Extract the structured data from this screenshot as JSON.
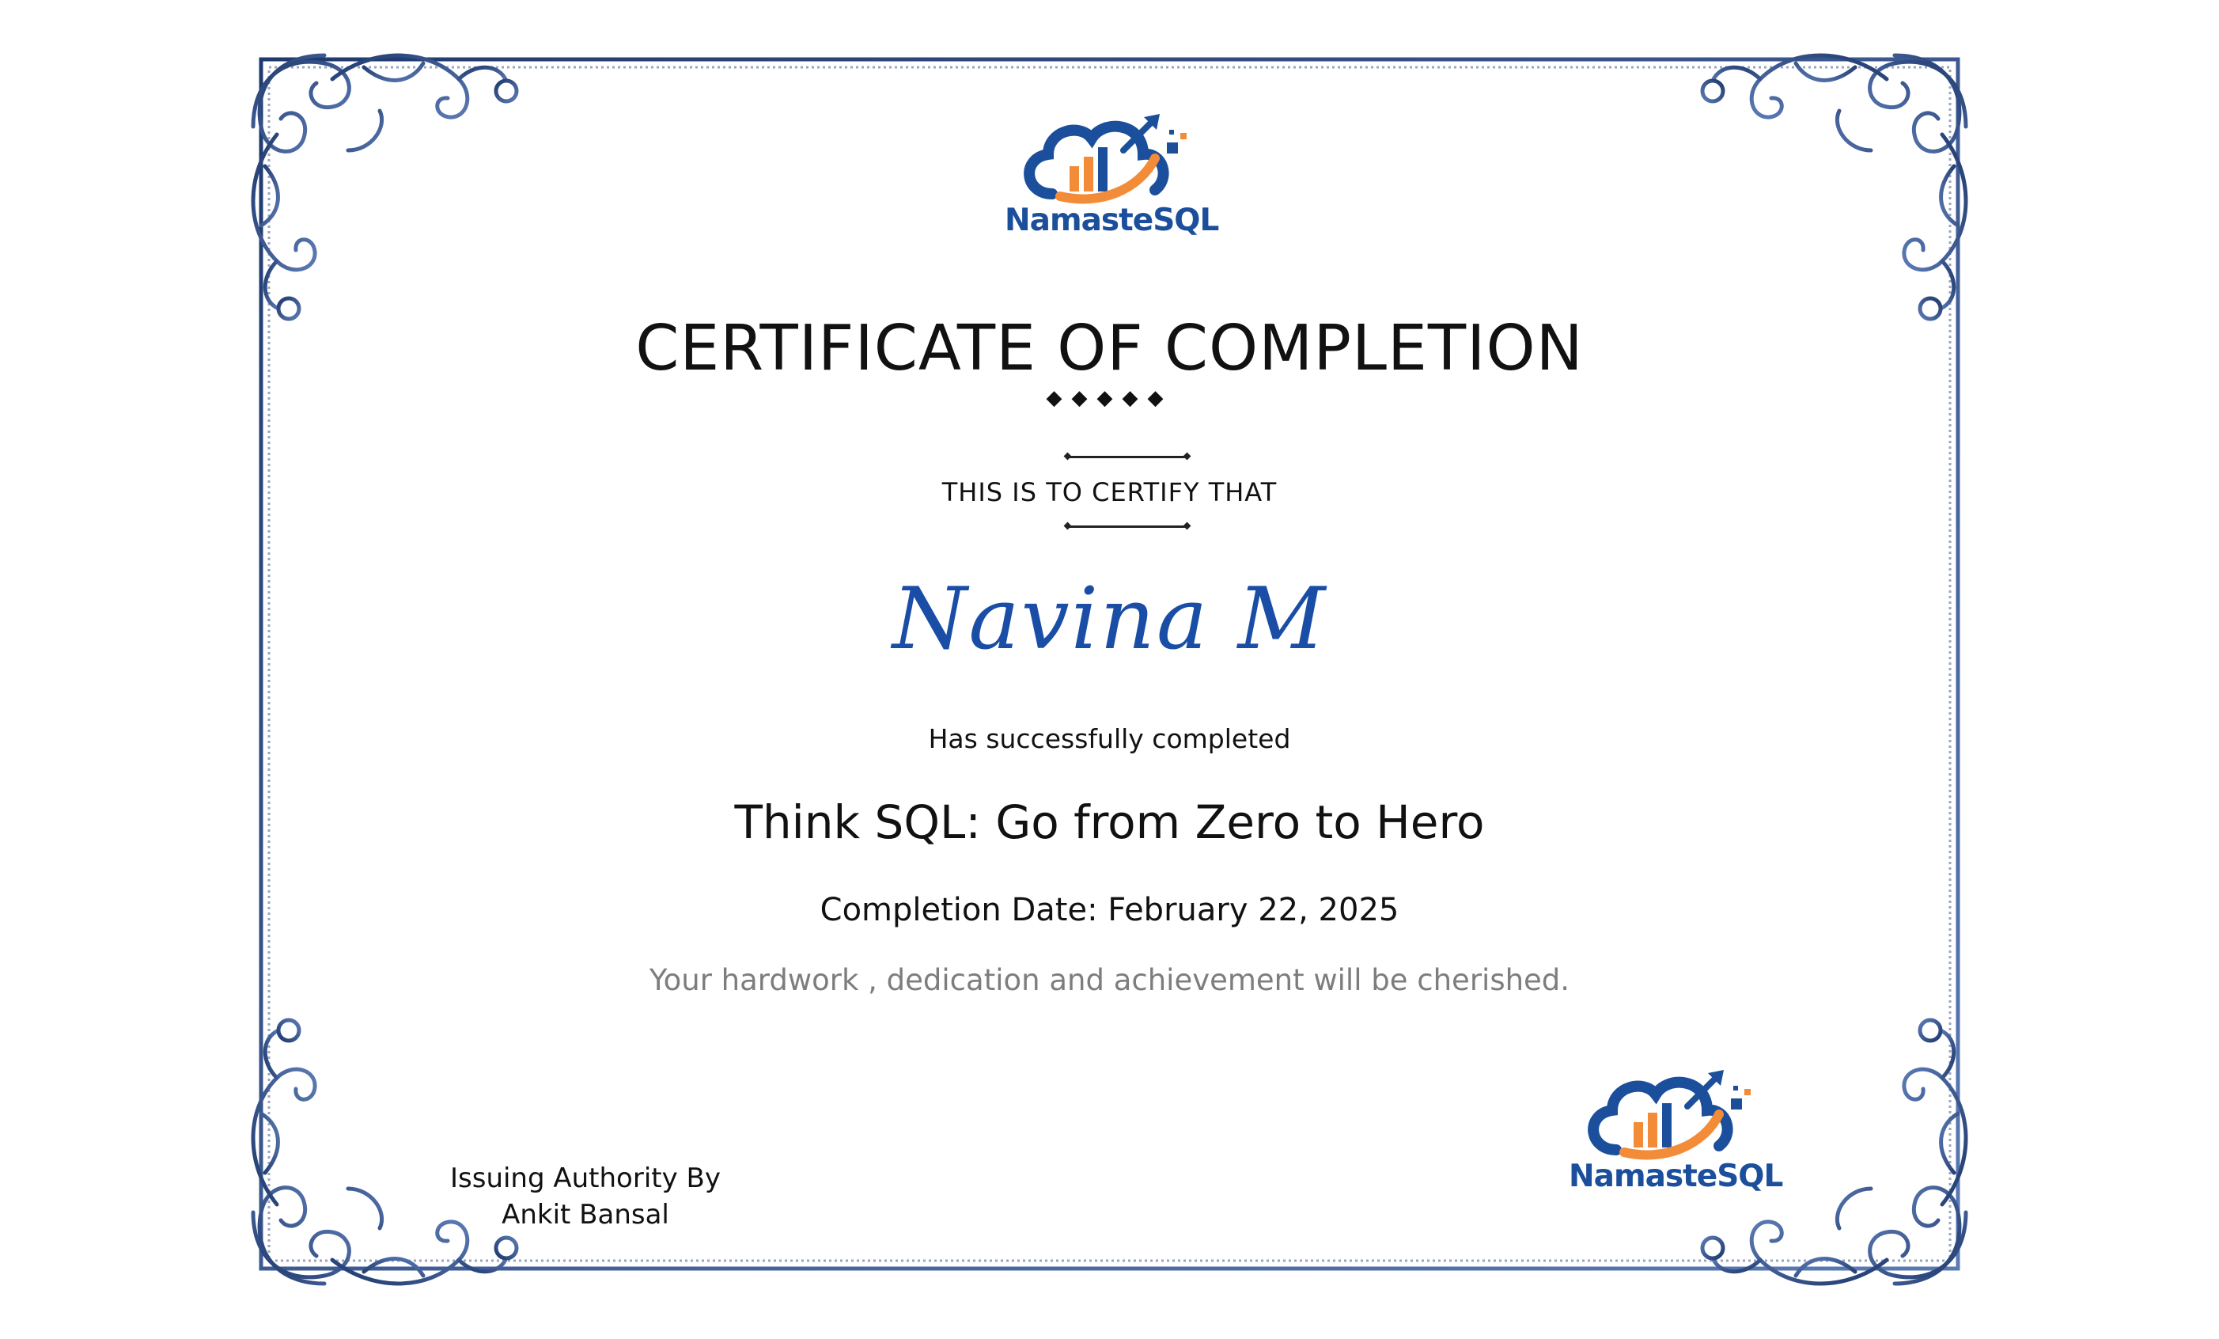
{
  "certificate": {
    "logo_top": {
      "brand": "NamasteSQL"
    },
    "title": "CERTIFICATE OF COMPLETION",
    "ornament": "◆◆◆◆◆",
    "certify_line": "THIS IS TO CERTIFY THAT",
    "recipient_name": "Navina M",
    "completed_line": "Has successfully completed",
    "course_name": "Think SQL: Go from Zero to Hero",
    "completion_date": "Completion Date: February 22, 2025",
    "message": "Your hardwork , dedication and achievement will be cherished.",
    "issuer": {
      "line1": "Issuing Authority By",
      "line2": "Ankit Bansal"
    },
    "logo_bottom": {
      "brand": "NamasteSQL"
    }
  },
  "colors": {
    "frame": "#1f3a6e",
    "frame_light": "#5b79b3",
    "recipient": "#1a4ea6",
    "brand_blue": "#1b4f9c",
    "brand_orange": "#f28c38",
    "message_gray": "#7d7d7d"
  },
  "icons": [
    "namastesql-logo-icon",
    "ornamental-corner-icon",
    "diamond-ornament-icon"
  ]
}
